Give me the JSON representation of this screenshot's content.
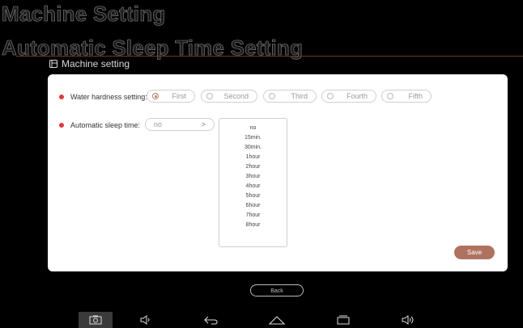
{
  "page": {
    "title": "Machine Setting",
    "subtitle": "Automatic Sleep Time Setting"
  },
  "breadcrumb": {
    "icon": "machine-settings-icon",
    "label": "Machine setting"
  },
  "water_hardness": {
    "label": "Water hardness setting:",
    "options": [
      "First",
      "Second",
      "Third",
      "Fourth",
      "Fifth"
    ],
    "selected": "First"
  },
  "sleep_time": {
    "label": "Automatic sleep time:",
    "value": "no",
    "arrow": ">",
    "options": [
      "no",
      "15min.",
      "30min.",
      "1hour",
      "2hour",
      "3hour",
      "4hour",
      "5hour",
      "6hour",
      "7hour",
      "8hour"
    ]
  },
  "buttons": {
    "save": "Save",
    "back": "Back"
  },
  "nav_bar": {
    "icons": [
      "screenshot-icon",
      "volume-down-icon",
      "back-icon",
      "home-icon",
      "recents-icon",
      "volume-up-icon"
    ]
  },
  "colors": {
    "accent": "#b07260",
    "required_dot": "#e0393e",
    "panel": "#ffffff",
    "background": "#000000"
  }
}
